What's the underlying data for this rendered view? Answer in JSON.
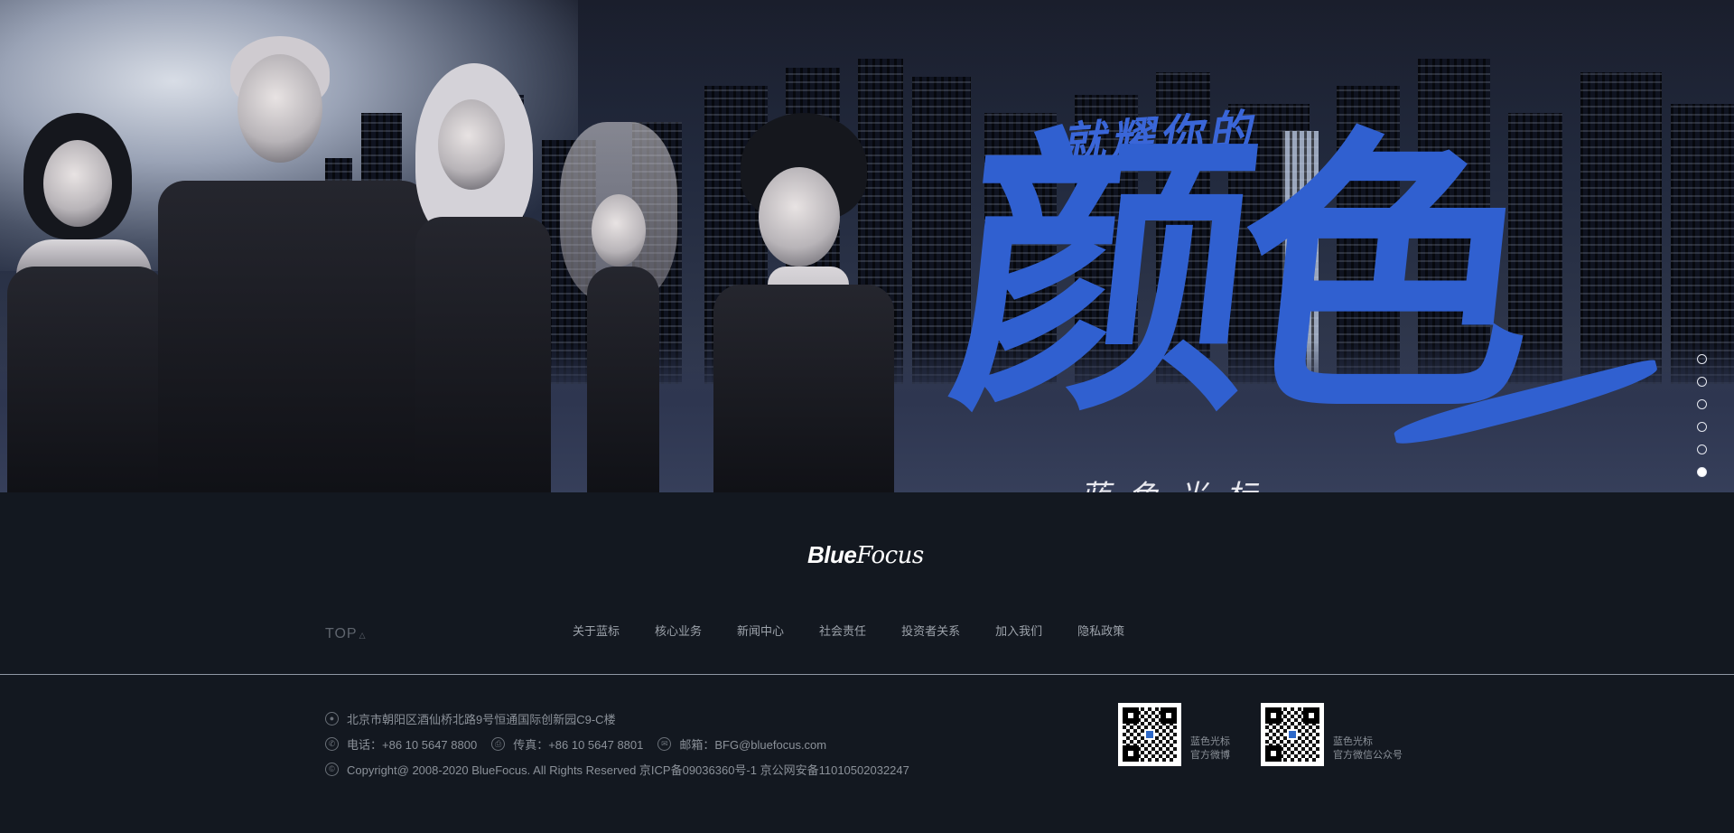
{
  "hero": {
    "calligraphy_small": "就耀你的",
    "calligraphy_big": "颜色",
    "calligraphy_bottom": "蓝色光标",
    "slides": [
      {
        "active": false
      },
      {
        "active": false
      },
      {
        "active": false
      },
      {
        "active": false
      },
      {
        "active": false
      },
      {
        "active": true
      }
    ]
  },
  "footer": {
    "logo_bold": "Blue",
    "logo_light": "Focus",
    "top_label": "TOP",
    "top_arrow": "△",
    "nav": [
      "关于蓝标",
      "核心业务",
      "新闻中心",
      "社会责任",
      "投资者关系",
      "加入我们",
      "隐私政策"
    ],
    "address_icon": "location-pin-icon",
    "address": "北京市朝阳区酒仙桥北路9号恒通国际创新园C9-C楼",
    "phone_label": "电话：+86 10 5647 8800",
    "fax_label": "传真：+86 10 5647 8801",
    "email_label": "邮箱：BFG@bluefocus.com",
    "copyright": "Copyright@ 2008-2020 BlueFocus. All Rights Reserved 京ICP备09036360号-1 京公网安备11010502032247",
    "qr_codes": [
      {
        "line1": "蓝色光标",
        "line2": "官方微博"
      },
      {
        "line1": "蓝色光标",
        "line2": "官方微信公众号"
      }
    ]
  },
  "colors": {
    "accent_blue": "#3060d0",
    "footer_bg": "#131820"
  }
}
